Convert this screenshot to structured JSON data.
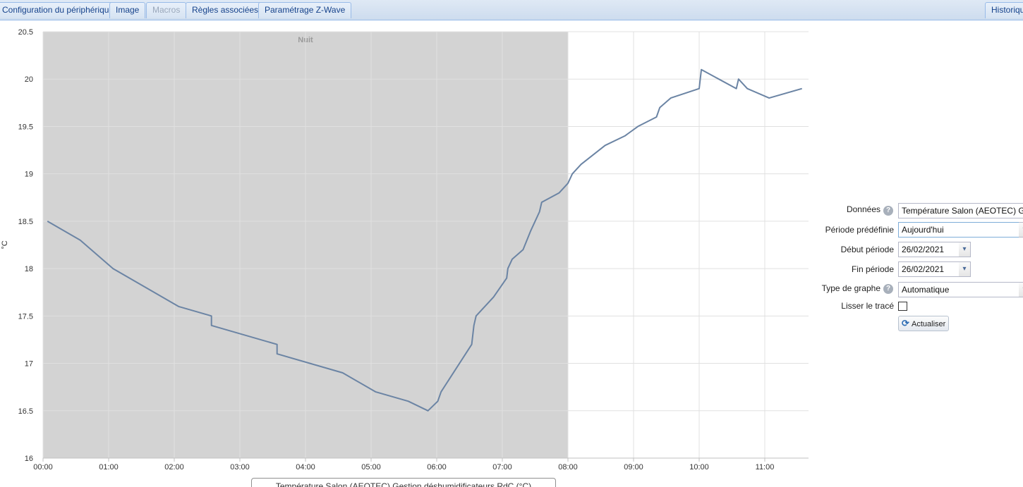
{
  "tabs": [
    {
      "label": "Configuration du périphérique",
      "enabled": true
    },
    {
      "label": "Image",
      "enabled": true
    },
    {
      "label": "Macros",
      "enabled": false
    },
    {
      "label": "Règles associées",
      "enabled": true
    },
    {
      "label": "Paramétrage Z-Wave",
      "enabled": true
    },
    {
      "label": "Historique",
      "enabled": true
    }
  ],
  "form": {
    "donnees_label": "Données",
    "donnees_value": "Température Salon (AEOTEC) Gestion déshumidificateurs RdC",
    "periode_label": "Période prédéfinie",
    "periode_value": "Aujourd'hui",
    "debut_label": "Début période",
    "debut_value": "26/02/2021",
    "fin_label": "Fin période",
    "fin_value": "26/02/2021",
    "type_label": "Type de graphe",
    "type_value": "Automatique",
    "lisser_label": "Lisser le tracé",
    "lisser_checked": false,
    "actualiser_label": "Actualiser",
    "help_glyph": "?"
  },
  "icons": {
    "help": "help-icon",
    "refresh": "refresh-icon",
    "dropdown": "chevron-down-icon"
  },
  "colors": {
    "series": "#6b84a4",
    "night_band": "#d3d3d3",
    "grid": "#e0e0e0",
    "tab_text": "#15428b"
  },
  "chart_data": {
    "type": "line",
    "ylabel": "°C",
    "ylim": [
      16,
      20.5
    ],
    "yticks": [
      "16",
      "16.5",
      "17",
      "17.5",
      "18",
      "18.5",
      "19",
      "19.5",
      "20",
      "20.5"
    ],
    "xlabels": [
      "00:00",
      "01:00",
      "02:00",
      "03:00",
      "04:00",
      "05:00",
      "06:00",
      "07:00",
      "08:00",
      "09:00",
      "10:00",
      "11:00"
    ],
    "bands": [
      {
        "label": "Nuit",
        "from": "00:00",
        "to": "08:00"
      }
    ],
    "legend": [
      "Température Salon (AEOTEC) Gestion déshumidificateurs RdC (°C)"
    ],
    "series": [
      {
        "name": "Température Salon (AEOTEC) Gestion déshumidificateurs RdC (°C)",
        "points": [
          [
            "00:04",
            18.5
          ],
          [
            "00:34",
            18.3
          ],
          [
            "01:04",
            18.0
          ],
          [
            "02:04",
            17.6
          ],
          [
            "02:34",
            17.5
          ],
          [
            "02:34",
            17.4
          ],
          [
            "03:34",
            17.2
          ],
          [
            "03:34",
            17.1
          ],
          [
            "04:34",
            16.9
          ],
          [
            "05:04",
            16.7
          ],
          [
            "05:34",
            16.6
          ],
          [
            "05:52",
            16.5
          ],
          [
            "06:01",
            16.6
          ],
          [
            "06:04",
            16.7
          ],
          [
            "06:32",
            17.2
          ],
          [
            "06:34",
            17.4
          ],
          [
            "06:36",
            17.5
          ],
          [
            "06:52",
            17.7
          ],
          [
            "07:04",
            17.9
          ],
          [
            "07:05",
            18.0
          ],
          [
            "07:09",
            18.1
          ],
          [
            "07:19",
            18.2
          ],
          [
            "07:26",
            18.4
          ],
          [
            "07:34",
            18.6
          ],
          [
            "07:36",
            18.7
          ],
          [
            "07:52",
            18.8
          ],
          [
            "08:00",
            18.9
          ],
          [
            "08:04",
            19.0
          ],
          [
            "08:12",
            19.1
          ],
          [
            "08:34",
            19.3
          ],
          [
            "08:52",
            19.4
          ],
          [
            "09:04",
            19.5
          ],
          [
            "09:21",
            19.6
          ],
          [
            "09:24",
            19.7
          ],
          [
            "09:34",
            19.8
          ],
          [
            "10:00",
            19.9
          ],
          [
            "10:02",
            20.1
          ],
          [
            "10:34",
            19.9
          ],
          [
            "10:36",
            20.0
          ],
          [
            "10:44",
            19.9
          ],
          [
            "11:04",
            19.8
          ],
          [
            "11:34",
            19.9
          ]
        ]
      }
    ]
  }
}
